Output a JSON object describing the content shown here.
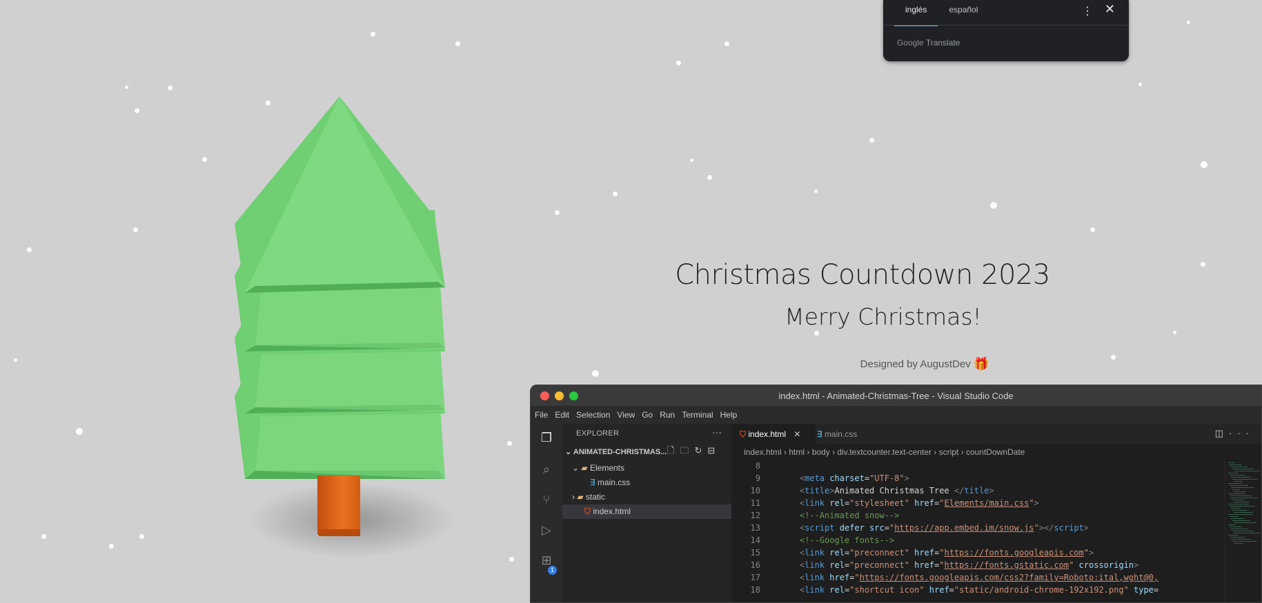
{
  "translate": {
    "tab_source": "inglés",
    "tab_target": "español",
    "brand": "Google Translate",
    "brand_google": "Google",
    "brand_translate": "Translate"
  },
  "page": {
    "title": "Christmas Countdown 2023",
    "subtitle": "Merry Christmas!",
    "designed_by": "Designed by AugustDev",
    "gift_icon": "🎁"
  },
  "vscode": {
    "window_title": "index.html - Animated-Christmas-Tree - Visual Studio Code",
    "menu": [
      "File",
      "Edit",
      "Selection",
      "View",
      "Go",
      "Run",
      "Terminal",
      "Help"
    ],
    "explorer_label": "EXPLORER",
    "explorer_more": "···",
    "project_folder": "ANIMATED-CHRISTMAS...",
    "tree": [
      {
        "label": "Elements",
        "kind": "folder-open"
      },
      {
        "label": "main.css",
        "kind": "css"
      },
      {
        "label": "static",
        "kind": "folder"
      },
      {
        "label": "index.html",
        "kind": "html"
      }
    ],
    "tabs": [
      {
        "label": "index.html",
        "active": true
      },
      {
        "label": "main.css",
        "active": false
      }
    ],
    "breadcrumb": [
      "index.html",
      "html",
      "body",
      "div.textcounter.text-center",
      "script",
      "countDownDate"
    ],
    "badge_count": "1",
    "code_lines": [
      {
        "n": "8",
        "tokens": []
      },
      {
        "n": "9",
        "tokens": [
          [
            "tg",
            "    <"
          ],
          [
            "tn",
            "meta"
          ],
          [
            "at",
            " charset"
          ],
          [
            "tx",
            "="
          ],
          [
            "st",
            "\"UTF-8\""
          ],
          [
            "tg",
            ">"
          ]
        ]
      },
      {
        "n": "10",
        "tokens": [
          [
            "tg",
            "    <"
          ],
          [
            "tn",
            "title"
          ],
          [
            "tg",
            ">"
          ],
          [
            "tx",
            "Animated Christmas Tree "
          ],
          [
            "tg",
            "</"
          ],
          [
            "tn",
            "title"
          ],
          [
            "tg",
            ">"
          ]
        ]
      },
      {
        "n": "11",
        "tokens": [
          [
            "tg",
            "    <"
          ],
          [
            "tn",
            "link"
          ],
          [
            "at",
            " rel"
          ],
          [
            "tx",
            "="
          ],
          [
            "st",
            "\"stylesheet\""
          ],
          [
            "at",
            " href"
          ],
          [
            "tx",
            "="
          ],
          [
            "st",
            "\""
          ],
          [
            "stu",
            "Elements/main.css"
          ],
          [
            "st",
            "\""
          ],
          [
            "tg",
            ">"
          ]
        ]
      },
      {
        "n": "12",
        "tokens": [
          [
            "cm",
            "    <!--Animated snow-->"
          ]
        ]
      },
      {
        "n": "13",
        "tokens": [
          [
            "tg",
            "    <"
          ],
          [
            "tn",
            "script"
          ],
          [
            "at",
            " defer src"
          ],
          [
            "tx",
            "="
          ],
          [
            "st",
            "\""
          ],
          [
            "stu",
            "https://app.embed.im/snow.js"
          ],
          [
            "st",
            "\""
          ],
          [
            "tg",
            "></"
          ],
          [
            "tn",
            "script"
          ],
          [
            "tg",
            ">"
          ]
        ]
      },
      {
        "n": "14",
        "tokens": [
          [
            "cm",
            "    <!--Google fonts-->"
          ]
        ]
      },
      {
        "n": "15",
        "tokens": [
          [
            "tg",
            "    <"
          ],
          [
            "tn",
            "link"
          ],
          [
            "at",
            " rel"
          ],
          [
            "tx",
            "="
          ],
          [
            "st",
            "\"preconnect\""
          ],
          [
            "at",
            " href"
          ],
          [
            "tx",
            "="
          ],
          [
            "st",
            "\""
          ],
          [
            "stu",
            "https://fonts.googleapis.com"
          ],
          [
            "st",
            "\""
          ],
          [
            "tg",
            ">"
          ]
        ]
      },
      {
        "n": "16",
        "tokens": [
          [
            "tg",
            "    <"
          ],
          [
            "tn",
            "link"
          ],
          [
            "at",
            " rel"
          ],
          [
            "tx",
            "="
          ],
          [
            "st",
            "\"preconnect\""
          ],
          [
            "at",
            " href"
          ],
          [
            "tx",
            "="
          ],
          [
            "st",
            "\""
          ],
          [
            "stu",
            "https://fonts.gstatic.com"
          ],
          [
            "st",
            "\""
          ],
          [
            "at",
            " crossorigin"
          ],
          [
            "tg",
            ">"
          ]
        ]
      },
      {
        "n": "17",
        "tokens": [
          [
            "tg",
            "    <"
          ],
          [
            "tn",
            "link"
          ],
          [
            "at",
            " href"
          ],
          [
            "tx",
            "="
          ],
          [
            "st",
            "\""
          ],
          [
            "stu",
            "https://fonts.googleapis.com/css2?family=Roboto:ital,wght@0,"
          ]
        ]
      },
      {
        "n": "18",
        "tokens": [
          [
            "tg",
            "    <"
          ],
          [
            "tn",
            "link"
          ],
          [
            "at",
            " rel"
          ],
          [
            "tx",
            "="
          ],
          [
            "st",
            "\"shortcut icon\""
          ],
          [
            "at",
            " href"
          ],
          [
            "tx",
            "="
          ],
          [
            "st",
            "\"static/android-chrome-192x192.png\""
          ],
          [
            "at",
            " type"
          ],
          [
            "tx",
            "="
          ]
        ]
      }
    ]
  },
  "colors": {
    "tree_green": "#6fd173",
    "trunk_orange": "#e0691a",
    "background": "#d0d0d0",
    "translate_accent": "#8ab4f8"
  }
}
